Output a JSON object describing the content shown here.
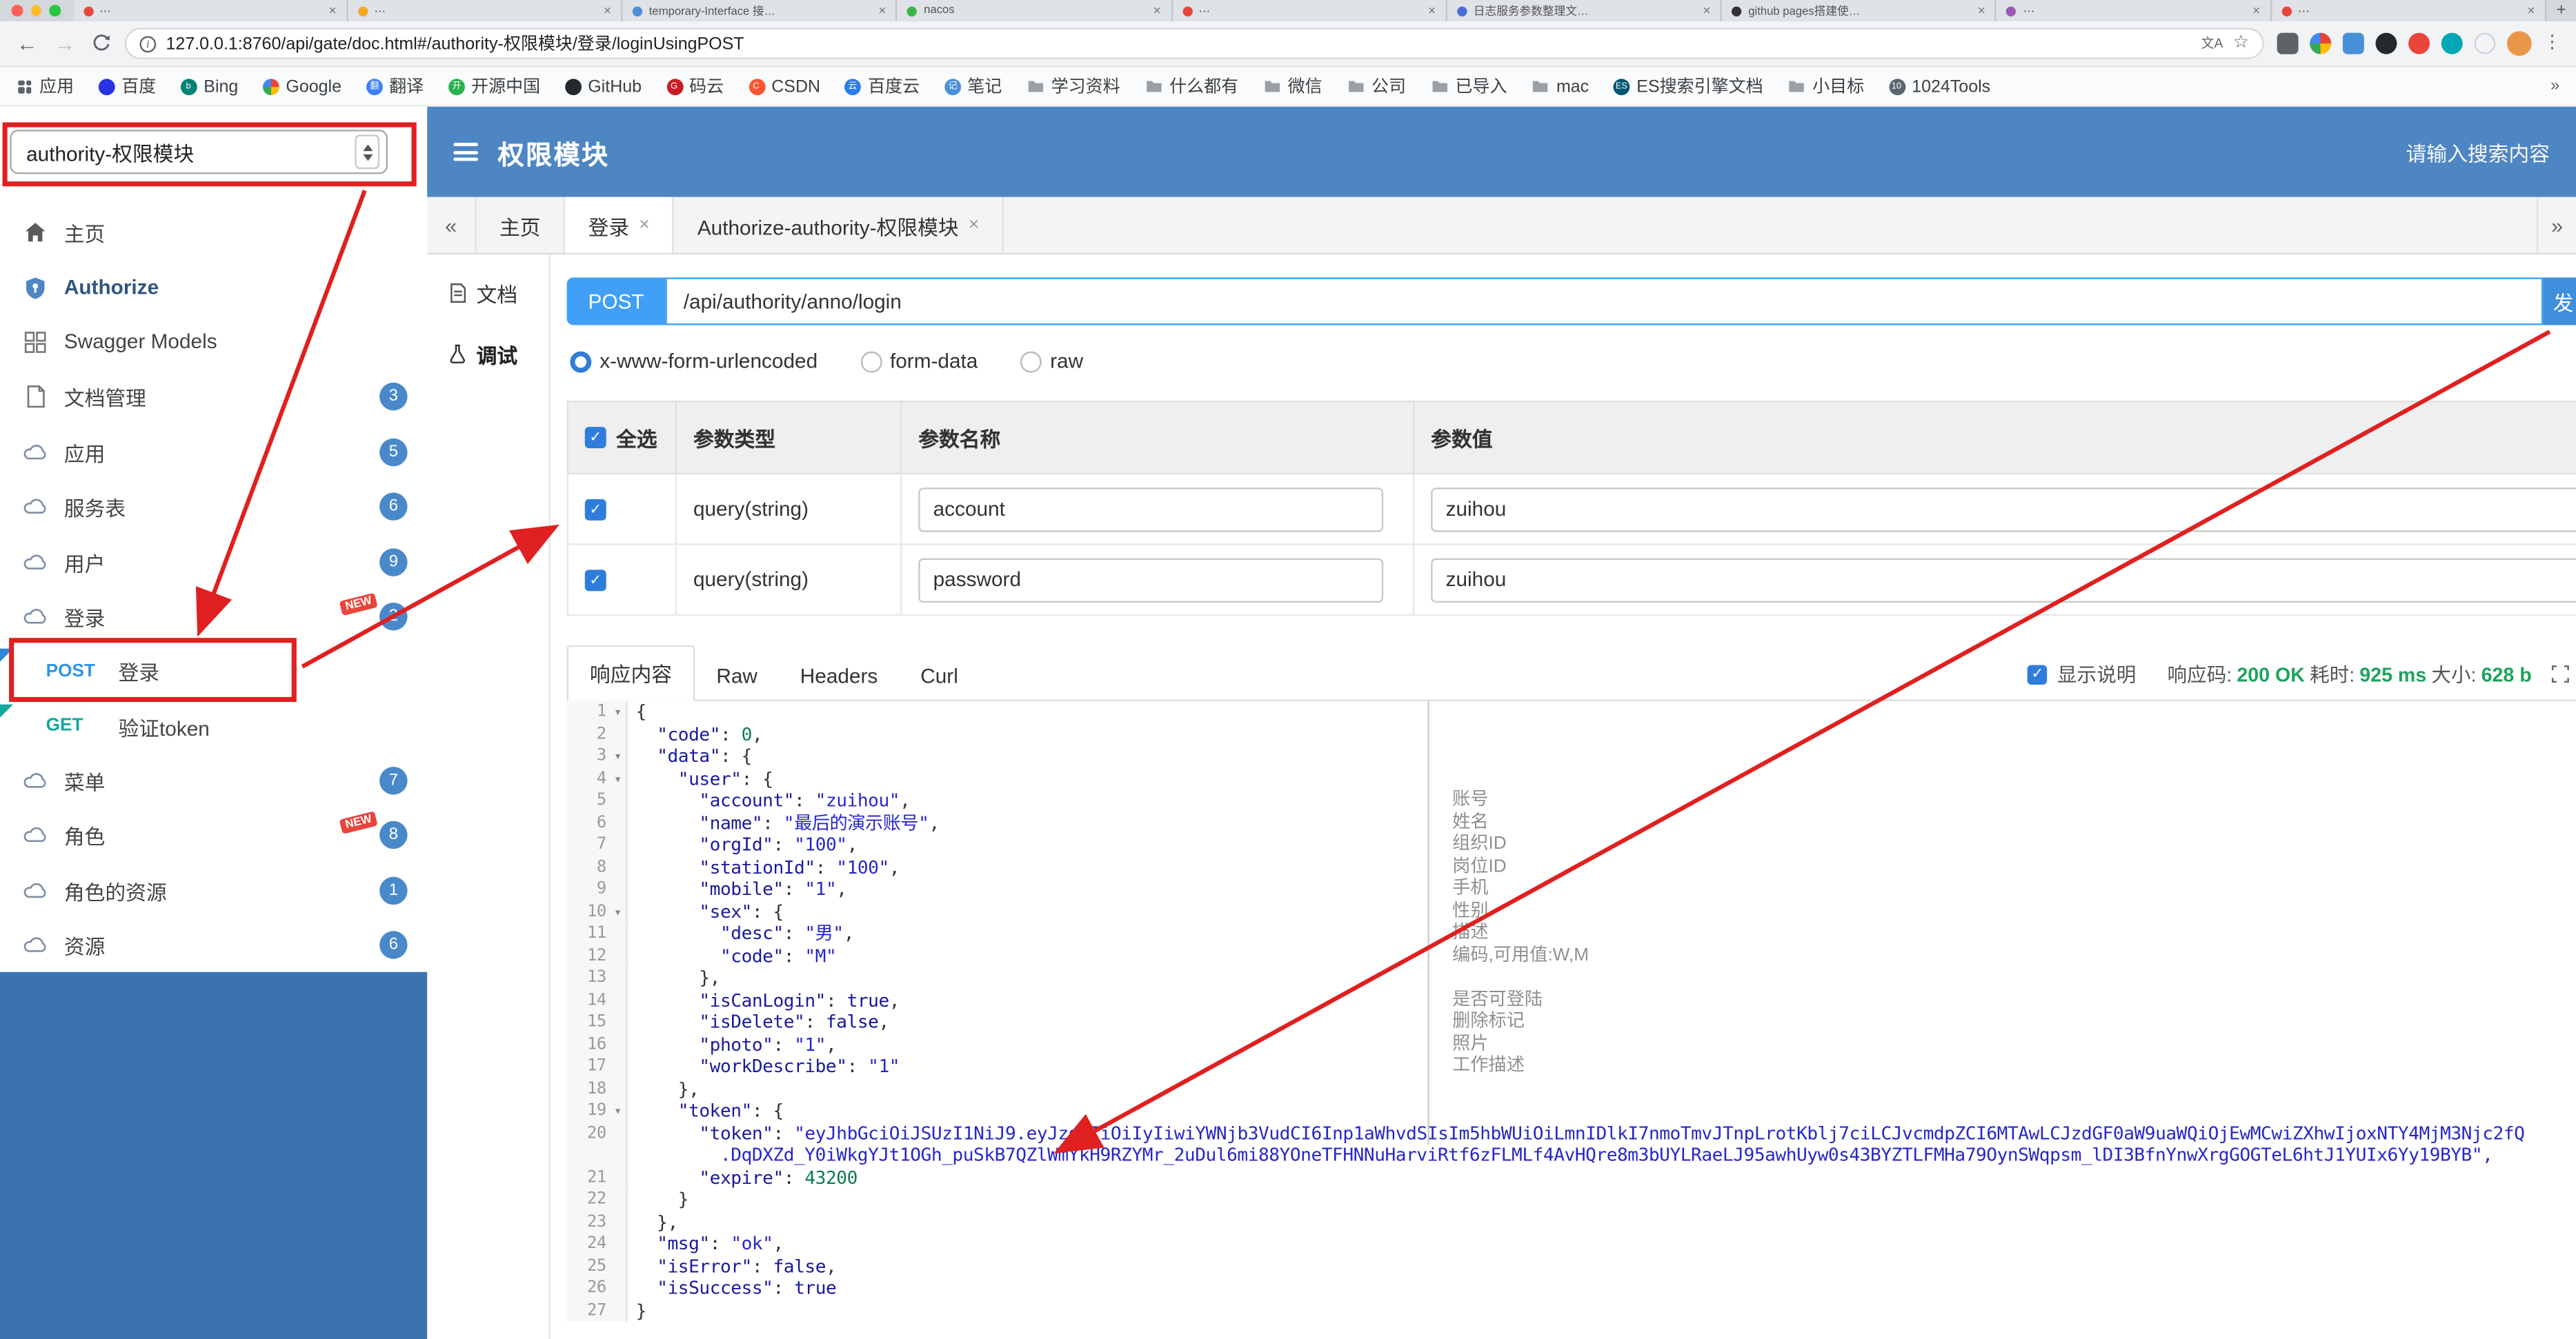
{
  "browser": {
    "tabs": [
      {
        "title": "⋯",
        "color": "#e8453c"
      },
      {
        "title": "⋯",
        "color": "#f5a623"
      },
      {
        "title": "temporary-Interface 接…",
        "color": "#4a90d9"
      },
      {
        "title": "nacos",
        "color": "#39b54a"
      },
      {
        "title": "⋯",
        "color": "#e8453c"
      },
      {
        "title": "日志服务参数整理文…",
        "color": "#4a6fd9"
      },
      {
        "title": "github pages搭建使…",
        "color": "#333333"
      },
      {
        "title": "⋯",
        "color": "#9b59b6"
      },
      {
        "title": "⋯",
        "color": "#e8453c"
      }
    ],
    "url": "127.0.0.1:8760/api/gate/doc.html#/authority-权限模块/登录/loginUsingPOST",
    "bookmarks": [
      {
        "label": "应用",
        "apps": true
      },
      {
        "label": "百度",
        "color": "#2932e1"
      },
      {
        "label": "Bing",
        "color": "#008373",
        "glyph": "b",
        "radius": "2px"
      },
      {
        "label": "Google",
        "google": true
      },
      {
        "label": "翻译",
        "color": "#3b82f6",
        "glyph": "翻",
        "radius": "2px"
      },
      {
        "label": "开源中国",
        "color": "#2bb24c",
        "glyph": "开"
      },
      {
        "label": "GitHub",
        "color": "#24292e"
      },
      {
        "label": "码云",
        "color": "#c71d23",
        "glyph": "G"
      },
      {
        "label": "CSDN",
        "color": "#fc5531",
        "glyph": "C"
      },
      {
        "label": "百度云",
        "color": "#2b7ce9",
        "glyph": "云"
      },
      {
        "label": "笔记",
        "color": "#4a90d9",
        "glyph": "记",
        "radius": "2px"
      },
      {
        "label": "学习资料",
        "folder": true
      },
      {
        "label": "什么都有",
        "folder": true
      },
      {
        "label": "微信",
        "folder": true
      },
      {
        "label": "公司",
        "folder": true
      },
      {
        "label": "已导入",
        "folder": true
      },
      {
        "label": "mac",
        "folder": true
      },
      {
        "label": "ES搜索引擎文档",
        "color": "#005571",
        "glyph": "ES",
        "radius": "2px"
      },
      {
        "label": "小目标",
        "folder": true
      },
      {
        "label": "1024Tools",
        "color": "#5a6570",
        "glyph": "10",
        "radius": "2px"
      }
    ]
  },
  "header": {
    "module_select": "authority-权限模块",
    "title": "权限模块",
    "search_placeholder": "请输入搜索内容"
  },
  "sidebar": {
    "items": [
      {
        "label": "主页"
      },
      {
        "label": "Authorize"
      },
      {
        "label": "Swagger Models"
      },
      {
        "label": "文档管理",
        "badge": "3"
      },
      {
        "label": "应用",
        "badge": "5"
      },
      {
        "label": "服务表",
        "badge": "6"
      },
      {
        "label": "用户",
        "badge": "9"
      },
      {
        "label": "登录",
        "badge": "2",
        "new": "NEW"
      },
      {
        "method": "POST",
        "label": "登录"
      },
      {
        "method": "GET",
        "label": "验证token"
      },
      {
        "label": "菜单",
        "badge": "7"
      },
      {
        "label": "角色",
        "badge": "8",
        "new": "NEW"
      },
      {
        "label": "角色的资源",
        "badge": "1"
      },
      {
        "label": "资源",
        "badge": "6"
      }
    ]
  },
  "doc_tabs": {
    "back": "«",
    "forward": "»",
    "tabs": [
      {
        "label": "主页"
      },
      {
        "label": "登录",
        "close": "×"
      },
      {
        "label": "Authorize-authority-权限模块",
        "close": "×"
      }
    ]
  },
  "rail": {
    "doc": "文档",
    "debug": "调试"
  },
  "request": {
    "method": "POST",
    "url": "/api/authority/anno/login",
    "send": "发",
    "content_types": [
      {
        "label": "x-www-form-urlencoded",
        "selected": true
      },
      {
        "label": "form-data"
      },
      {
        "label": "raw"
      }
    ]
  },
  "params": {
    "headers": {
      "all": "全选",
      "type": "参数类型",
      "name": "参数名称",
      "value": "参数值"
    },
    "rows": [
      {
        "type": "query(string)",
        "name": "account",
        "value": "zuihou"
      },
      {
        "type": "query(string)",
        "name": "password",
        "value": "zuihou"
      }
    ]
  },
  "response": {
    "tabs": [
      {
        "label": "响应内容",
        "active": true
      },
      {
        "label": "Raw"
      },
      {
        "label": "Headers"
      },
      {
        "label": "Curl"
      }
    ],
    "show_desc": "显示说明",
    "meta": [
      {
        "label": "响应码:",
        "value": "200 OK"
      },
      {
        "label": "耗时:",
        "value": "925 ms"
      },
      {
        "label": "大小:",
        "value": "628 b"
      }
    ]
  },
  "editor": {
    "lines": [
      {
        "n": "1",
        "fold": true,
        "t": "{"
      },
      {
        "n": "2",
        "t": "  \"code\": 0,"
      },
      {
        "n": "3",
        "fold": true,
        "t": "  \"data\": {"
      },
      {
        "n": "4",
        "fold": true,
        "t": "    \"user\": {"
      },
      {
        "n": "5",
        "t": "      \"account\": \"zuihou\","
      },
      {
        "n": "6",
        "t": "      \"name\": \"最后的演示账号\","
      },
      {
        "n": "7",
        "t": "      \"orgId\": \"100\","
      },
      {
        "n": "8",
        "t": "      \"stationId\": \"100\","
      },
      {
        "n": "9",
        "t": "      \"mobile\": \"1\","
      },
      {
        "n": "10",
        "fold": true,
        "t": "      \"sex\": {"
      },
      {
        "n": "11",
        "t": "        \"desc\": \"男\","
      },
      {
        "n": "12",
        "t": "        \"code\": \"M\""
      },
      {
        "n": "13",
        "t": "      },"
      },
      {
        "n": "14",
        "t": "      \"isCanLogin\": true,"
      },
      {
        "n": "15",
        "t": "      \"isDelete\": false,"
      },
      {
        "n": "16",
        "t": "      \"photo\": \"1\","
      },
      {
        "n": "17",
        "t": "      \"workDescribe\": \"1\""
      },
      {
        "n": "18",
        "t": "    },"
      },
      {
        "n": "19",
        "fold": true,
        "t": "    \"token\": {"
      },
      {
        "n": "20",
        "t": "      \"token\": \"eyJhbGciOiJSUzI1NiJ9.eyJzdWIiOiIyIiwiYWNjb3VudCI6Inp1aWhvdSIsIm5hbWUiOiLmnIDlkI7nmoTmvJTnpLrotKblj7ciLCJvcmdpZCI6MTAwLCJzdGF0aW9uaWQiOjEwMCwiZXhwIjoxNTY4MjM3Njc2fQ"
      },
      {
        "n": "",
        "f": true,
        "t": "        .DqDXZd_Y0iWkgYJt1OGh_puSkB7QZlWmYkH9RZYMr_2uDul6mi88YOneTFHNNuHarviRtf6zFLMLf4AvHQre8m3bUYLRaeLJ95awhUyw0s43BYZTLFMHa79OynSWqpsm_lDI3BfnYnwXrgGOGTeL6htJ1YUIx6Yy19BYB\","
      },
      {
        "n": "21",
        "t": "      \"expire\": 43200"
      },
      {
        "n": "22",
        "t": "    }"
      },
      {
        "n": "23",
        "t": "  },"
      },
      {
        "n": "24",
        "t": "  \"msg\": \"ok\","
      },
      {
        "n": "25",
        "t": "  \"isError\": false,"
      },
      {
        "n": "26",
        "t": "  \"isSuccess\": true"
      },
      {
        "n": "27",
        "t": "}"
      }
    ],
    "annotations": [
      "",
      "",
      "",
      "",
      "账号",
      "姓名",
      "组织ID",
      "岗位ID",
      "手机",
      "性别",
      "描述",
      "编码,可用值:W,M",
      "",
      "是否可登陆",
      "删除标记",
      "照片",
      "工作描述"
    ]
  },
  "colors": {
    "header_blue": "#4e86c3",
    "annotation_red": "#e02020",
    "status_green": "#1fa35c",
    "method_badge_blue": "#41a0f5"
  }
}
